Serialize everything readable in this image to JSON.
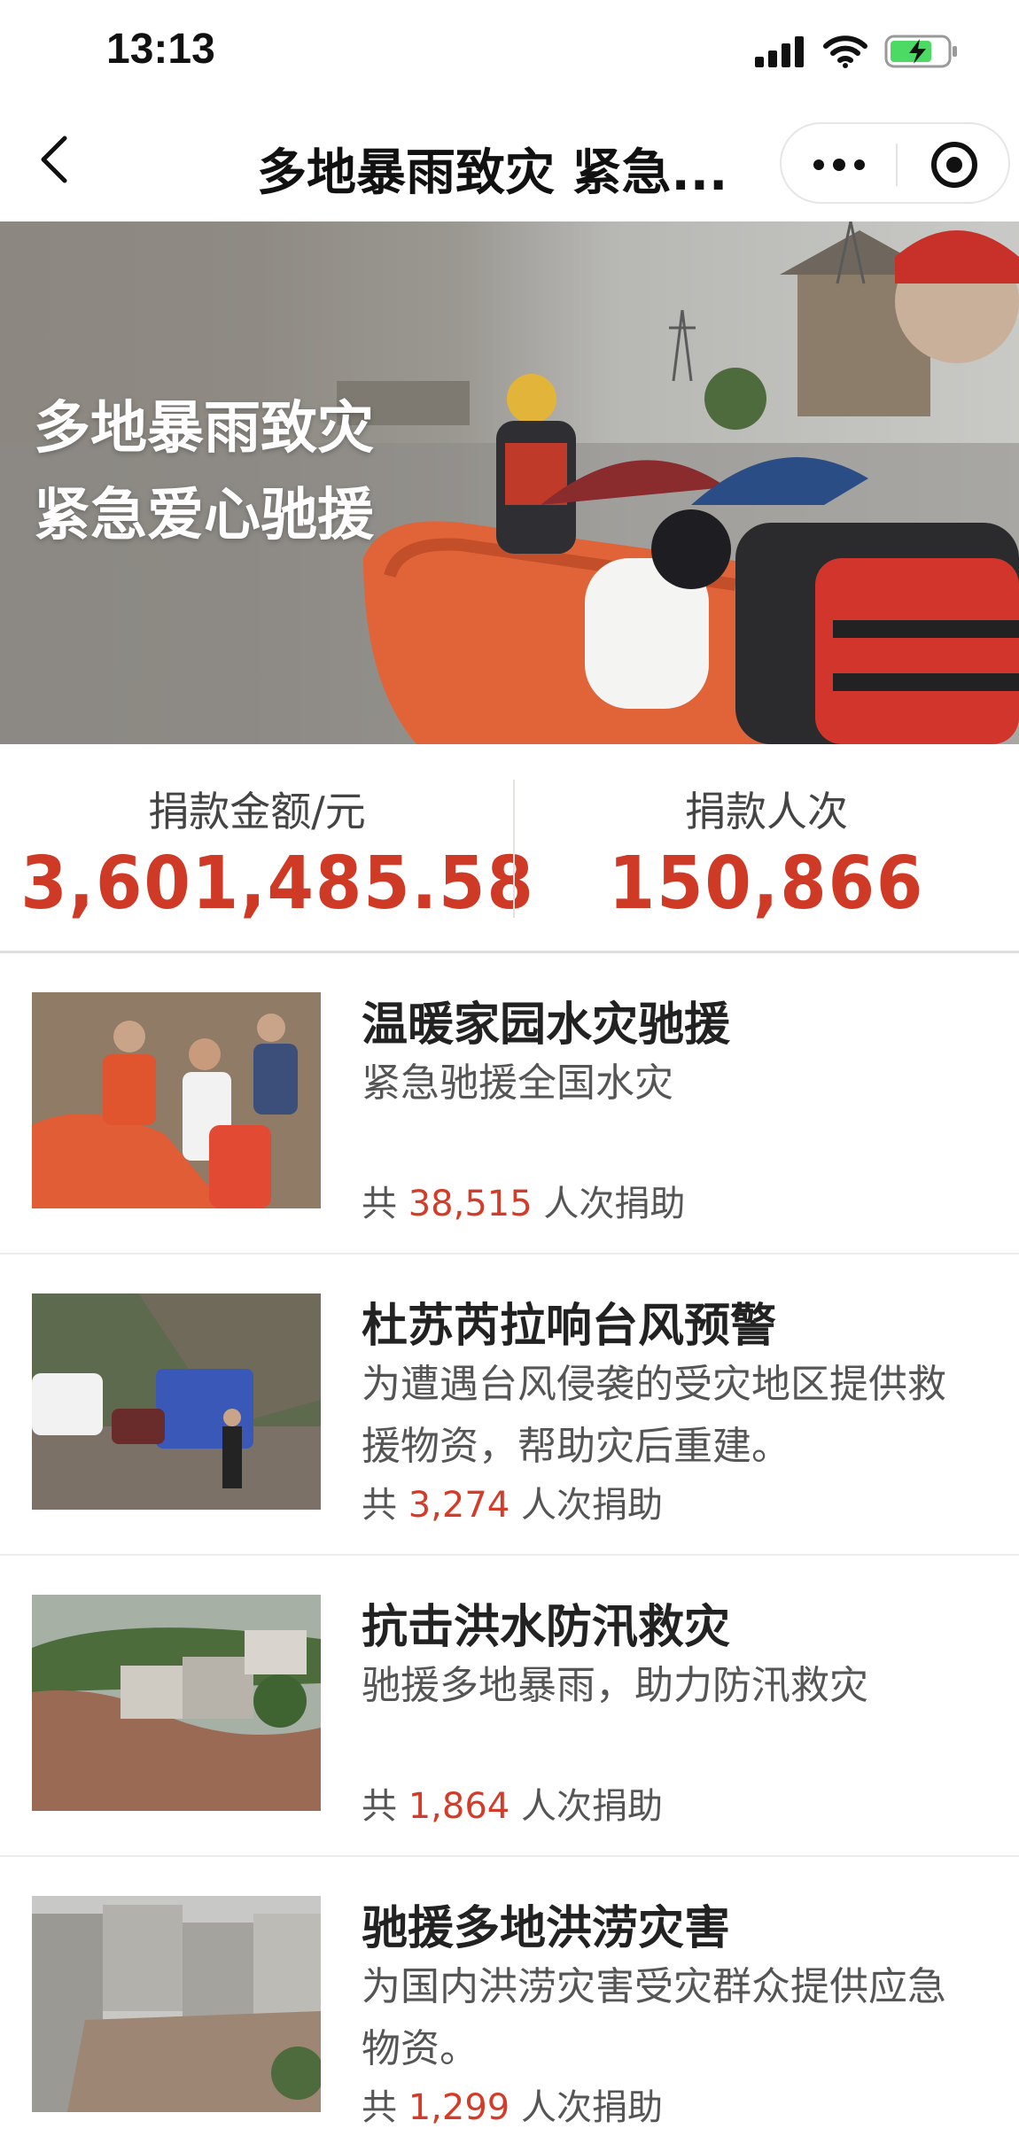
{
  "status_bar": {
    "time": "13:13"
  },
  "nav": {
    "title": "多地暴雨致灾 紧急..."
  },
  "hero": {
    "line1": "多地暴雨致灾",
    "line2": "紧急爱心驰援"
  },
  "stats": {
    "amount_label": "捐款金额/元",
    "amount_value": "3,601,485.58",
    "donors_label": "捐款人次",
    "donors_value": "150,866"
  },
  "projects": [
    {
      "title": "温暖家园水灾驰援",
      "desc": "紧急驰援全国水灾",
      "count_prefix": "共",
      "count": "38,515",
      "count_suffix": "人次捐助"
    },
    {
      "title": "杜苏芮拉响台风预警",
      "desc": "为遭遇台风侵袭的受灾地区提供救援物资，帮助灾后重建。",
      "count_prefix": "共",
      "count": "3,274",
      "count_suffix": "人次捐助"
    },
    {
      "title": "抗击洪水防汛救灾",
      "desc": "驰援多地暴雨，助力防汛救灾",
      "count_prefix": "共",
      "count": "1,864",
      "count_suffix": "人次捐助"
    },
    {
      "title": "驰援多地洪涝灾害",
      "desc": "为国内洪涝灾害受灾群众提供应急物资。",
      "count_prefix": "共",
      "count": "1,299",
      "count_suffix": "人次捐助"
    }
  ],
  "colors": {
    "accent": "#cf3a27",
    "text": "#222222",
    "muted": "#555555"
  },
  "icons": [
    "signal-icon",
    "wifi-icon",
    "battery-icon",
    "back-icon",
    "more-icon",
    "target-icon"
  ]
}
